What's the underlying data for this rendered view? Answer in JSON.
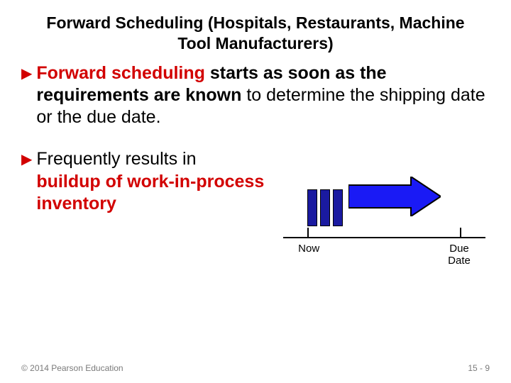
{
  "title": "Forward Scheduling (Hospitals, Restaurants, Machine Tool Manufacturers)",
  "bullet1": {
    "p1": "Forward scheduling",
    "p2": " starts as soon as the requirements are known",
    "p3": " to determine the shipping date or the due date."
  },
  "bullet2": {
    "p1": "Frequently results in ",
    "p2": "buildup of work-in-process inventory"
  },
  "diagram": {
    "now_label": "Now",
    "due_label": "Due Date"
  },
  "footer": {
    "copyright": "© 2014 Pearson Education",
    "pagenum": "15 - 9"
  }
}
